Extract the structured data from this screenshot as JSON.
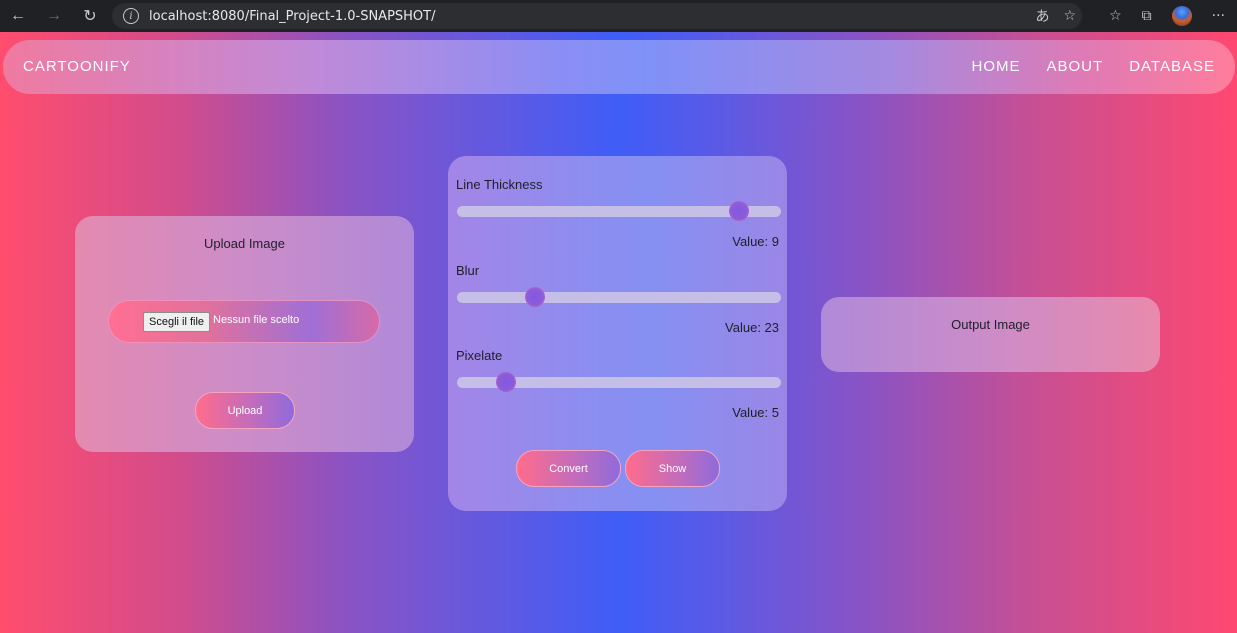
{
  "browser": {
    "url": "localhost:8080/Final_Project-1.0-SNAPSHOT/",
    "icons": [
      "back-arrow-icon",
      "forward-arrow-icon",
      "refresh-icon",
      "info-icon",
      "translate-icon",
      "add-favorite-icon",
      "favorites-icon",
      "collections-icon",
      "profile-avatar",
      "more-icon"
    ]
  },
  "header": {
    "brand": "CARTOONIFY",
    "menu": [
      "HOME",
      "ABOUT",
      "DATABASE"
    ]
  },
  "upload": {
    "title": "Upload Image",
    "file_button": "Scegli il file",
    "file_status": "Nessun file scelto",
    "upload_button": "Upload"
  },
  "controls": {
    "sliders": [
      {
        "label": "Line Thickness",
        "value_text": "Value: 9",
        "position": 0.87
      },
      {
        "label": "Blur",
        "value_text": "Value: 23",
        "position": 0.24
      },
      {
        "label": "Pixelate",
        "value_text": "Value: 5",
        "position": 0.15
      }
    ],
    "convert_button": "Convert",
    "show_button": "Show"
  },
  "output": {
    "title": "Output Image"
  }
}
